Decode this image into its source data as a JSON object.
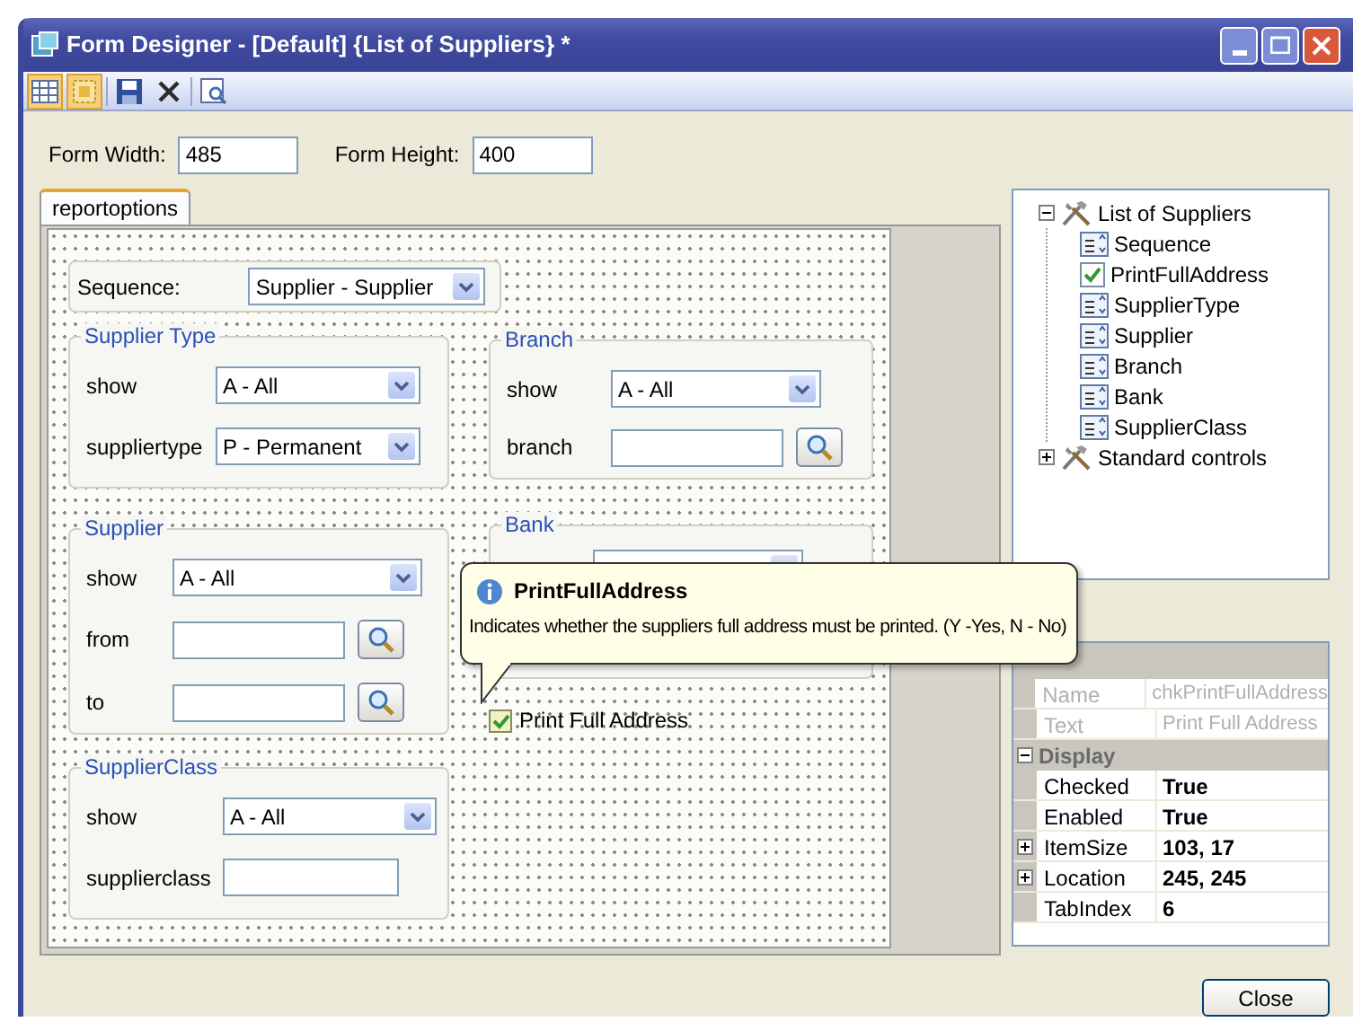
{
  "window": {
    "title": "Form Designer - [Default] {List of Suppliers} *"
  },
  "toolbar": [
    {
      "kind": "grid",
      "selected": true
    },
    {
      "kind": "snap",
      "selected": true
    },
    {
      "kind": "save",
      "selected": false
    },
    {
      "kind": "delete",
      "selected": false
    },
    {
      "kind": "preview",
      "selected": false
    }
  ],
  "form_size": [
    {
      "label": "Form Width:",
      "value": "485"
    },
    {
      "label": "Form Height:",
      "value": "400"
    }
  ],
  "tabs": [
    {
      "label": "reportoptions",
      "selected": true
    }
  ],
  "form": {
    "sequence": {
      "label": "Sequence:",
      "value": "Supplier - Supplier"
    },
    "groups": [
      {
        "title": "Supplier Type",
        "rows": [
          {
            "kind": "select",
            "label": "show",
            "value": "A - All"
          },
          {
            "kind": "select",
            "label": "suppliertype",
            "value": "P - Permanent"
          }
        ]
      },
      {
        "title": "Branch",
        "rows": [
          {
            "kind": "select",
            "label": "show",
            "value": "A - All"
          },
          {
            "kind": "lookup",
            "label": "branch"
          }
        ]
      },
      {
        "title": "Supplier",
        "rows": [
          {
            "kind": "select",
            "label": "show",
            "value": "A - All"
          },
          {
            "kind": "lookup",
            "label": "from"
          },
          {
            "kind": "lookup",
            "label": "to"
          }
        ]
      },
      {
        "title": "Bank"
      },
      {
        "title": "SupplierClass",
        "rows": [
          {
            "kind": "select",
            "label": "show",
            "value": "A - All"
          },
          {
            "kind": "text",
            "label": "supplierclass"
          }
        ]
      }
    ],
    "checkbox": {
      "label": "Print Full Address",
      "checked": true
    }
  },
  "tooltip": {
    "title": "PrintFullAddress",
    "text": "Indicates whether the suppliers full address must be printed. (Y -Yes, N - No)"
  },
  "tree": [
    {
      "label": "List of Suppliers",
      "expanded": true,
      "children": [
        {
          "label": "Sequence",
          "kind": "combo"
        },
        {
          "label": "PrintFullAddress",
          "kind": "check"
        },
        {
          "label": "SupplierType",
          "kind": "combo"
        },
        {
          "label": "Supplier",
          "kind": "combo"
        },
        {
          "label": "Branch",
          "kind": "combo"
        },
        {
          "label": "Bank",
          "kind": "combo"
        },
        {
          "label": "SupplierClass",
          "kind": "combo"
        }
      ]
    },
    {
      "label": "Standard controls",
      "expanded": false
    }
  ],
  "properties": [
    {
      "kind": "property",
      "name": "Name",
      "value": "chkPrintFullAddress",
      "disabled": true,
      "expandable": false
    },
    {
      "kind": "property",
      "name": "Text",
      "value": "Print Full Address",
      "disabled": true,
      "expandable": false
    },
    {
      "kind": "category",
      "name": "Display",
      "expanded": true
    },
    {
      "kind": "property",
      "name": "Checked",
      "value": "True",
      "disabled": false,
      "expandable": false
    },
    {
      "kind": "property",
      "name": "Enabled",
      "value": "True",
      "disabled": false,
      "expandable": false
    },
    {
      "kind": "property",
      "name": "ItemSize",
      "value": "103, 17",
      "disabled": false,
      "expandable": true
    },
    {
      "kind": "property",
      "name": "Location",
      "value": "245, 245",
      "disabled": false,
      "expandable": true
    },
    {
      "kind": "property",
      "name": "TabIndex",
      "value": "6",
      "disabled": false,
      "expandable": false
    }
  ],
  "close_button": "Close"
}
